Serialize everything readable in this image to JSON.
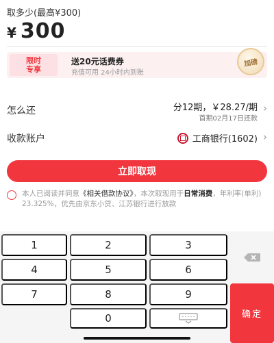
{
  "amount": {
    "label": "取多少(最高¥300)",
    "currency": "¥",
    "value": "300"
  },
  "promo": {
    "tag_line1": "限时",
    "tag_line2": "专享",
    "title": "送20元话费券",
    "subtitle": "充值可用  24小时内到账",
    "badge": "加磅"
  },
  "repay": {
    "label": "怎么还",
    "plan": "分12期，￥28.27/期",
    "first_due": "首期02月17日还款"
  },
  "account": {
    "label": "收款账户",
    "bank": "工商银行(1602)"
  },
  "cta_label": "立即取现",
  "agreement": {
    "prefix": "本人已阅读并同意",
    "link": "《相关借款协议》",
    "middle": "，本次取现用于",
    "purpose": "日常消费",
    "suffix": "，年利率(单利) 23.325%，优先由京东小贷、江苏银行进行放款"
  },
  "keypad": {
    "keys": [
      "1",
      "2",
      "3",
      "4",
      "5",
      "6",
      "7",
      "8",
      "9",
      "0"
    ],
    "confirm": "确定"
  },
  "colors": {
    "accent": "#f2363e",
    "promo_bg": "#fdf0f1"
  }
}
